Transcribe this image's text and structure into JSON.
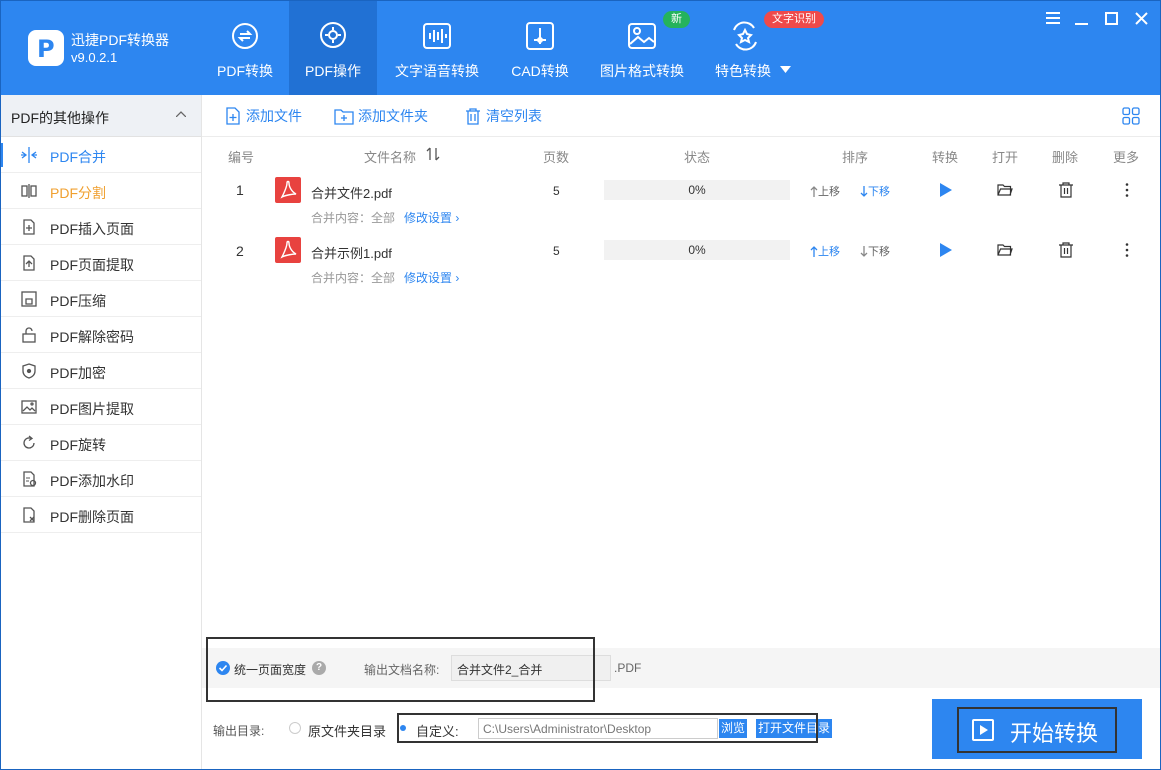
{
  "app": {
    "name": "迅捷PDF转换器",
    "version": "v9.0.2.1"
  },
  "nav": {
    "tabs": [
      {
        "label": "PDF转换"
      },
      {
        "label": "PDF操作"
      },
      {
        "label": "文字语音转换"
      },
      {
        "label": "CAD转换"
      },
      {
        "label": "图片格式转换"
      },
      {
        "label": "特色转换"
      }
    ],
    "badge_new": "新",
    "badge_ocr": "文字识别"
  },
  "sidebar": {
    "title": "PDF的其他操作",
    "items": [
      {
        "label": "PDF合并"
      },
      {
        "label": "PDF分割"
      },
      {
        "label": "PDF插入页面"
      },
      {
        "label": "PDF页面提取"
      },
      {
        "label": "PDF压缩"
      },
      {
        "label": "PDF解除密码"
      },
      {
        "label": "PDF加密"
      },
      {
        "label": "PDF图片提取"
      },
      {
        "label": "PDF旋转"
      },
      {
        "label": "PDF添加水印"
      },
      {
        "label": "PDF删除页面"
      }
    ]
  },
  "toolbar": {
    "add_file": "添加文件",
    "add_folder": "添加文件夹",
    "clear_list": "清空列表"
  },
  "table": {
    "headers": {
      "num": "编号",
      "name": "文件名称",
      "pages": "页数",
      "status": "状态",
      "sort": "排序",
      "convert": "转换",
      "open": "打开",
      "delete": "删除",
      "more": "更多"
    },
    "sort_up": "上移",
    "sort_down": "下移",
    "rows": [
      {
        "num": "1",
        "name": "合并文件2.pdf",
        "sub": "合并内容：全部",
        "modify": "修改设置",
        "pages": "5",
        "progress": "0%"
      },
      {
        "num": "2",
        "name": "合并示例1.pdf",
        "sub": "合并内容：全部",
        "modify": "修改设置",
        "pages": "5",
        "progress": "0%"
      }
    ]
  },
  "options": {
    "uniform_width": "统一页面宽度",
    "help": "?",
    "output_name_label": "输出文档名称:",
    "output_name_value": "合并文件2_合并",
    "ext": ".PDF"
  },
  "output": {
    "label": "输出目录:",
    "original_folder": "原文件夹目录",
    "custom": "自定义:",
    "path": "C:\\Users\\Administrator\\Desktop",
    "browse": "浏览",
    "open_folder": "打开文件目录"
  },
  "start_button": "开始转换",
  "colors": {
    "primary": "#2d86f0",
    "active_tab": "#2171d4",
    "pdf_red": "#e8423f",
    "badge_green": "#25b35c",
    "badge_red": "#ef4a4a"
  }
}
